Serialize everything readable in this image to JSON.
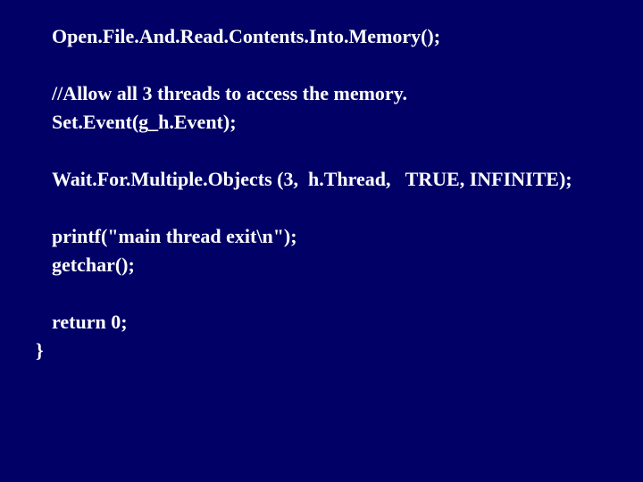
{
  "code": {
    "l1": "Open.File.And.Read.Contents.Into.Memory();",
    "l2": "//Allow all 3 threads to access the memory.",
    "l3": "Set.Event(g_h.Event);",
    "l4": "Wait.For.Multiple.Objects (3,  h.Thread,   TRUE, INFINITE);",
    "l5": "printf(\"main thread exit\\n\");",
    "l6": "getchar();",
    "l7": "return 0;",
    "l8": "}"
  }
}
